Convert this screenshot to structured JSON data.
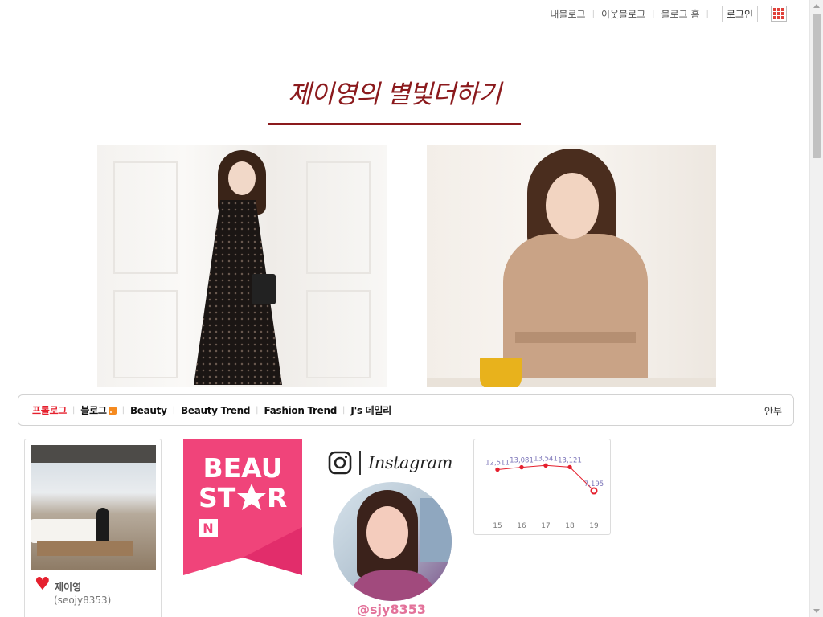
{
  "topnav": {
    "my_blog": "내블로그",
    "neighbor_blog": "이웃블로그",
    "blog_home": "블로그 홈",
    "login": "로그인"
  },
  "blog": {
    "title": "제이영의 별빛더하기"
  },
  "categories": {
    "items": [
      "프롤로그",
      "블로그",
      "Beauty",
      "Beauty Trend",
      "Fashion Trend",
      "J's 데일리"
    ],
    "active": "프롤로그",
    "guide": "안부"
  },
  "profile": {
    "nickname": "제이영",
    "user_id": "(seojy8353)"
  },
  "badge": {
    "line1": "BEAU",
    "line2_a": "ST",
    "line2_b": "R",
    "mark": "N"
  },
  "instagram": {
    "wordmark": "Instagram",
    "handle": "@sjy8353"
  },
  "colors": {
    "title": "#8b1a1d",
    "active_category": "#e5202e",
    "badge_pink": "#f0447a",
    "chart_line": "#e5202e",
    "chart_label": "#7b74b8",
    "handle": "#e3729a"
  },
  "chart_data": {
    "type": "line",
    "x": [
      "15",
      "16",
      "17",
      "18",
      "19"
    ],
    "values": [
      12511,
      13081,
      13541,
      13121,
      7195
    ],
    "labels": [
      "12,511",
      "13,081",
      "13,541",
      "13,121",
      "7,195"
    ],
    "ylim": [
      5000,
      16000
    ]
  }
}
